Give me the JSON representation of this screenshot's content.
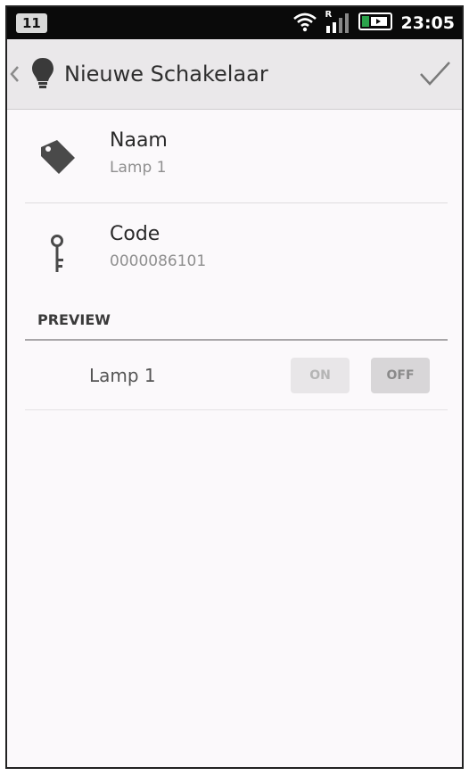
{
  "status_bar": {
    "notification_count": "11",
    "signal_label": "R",
    "time": "23:05"
  },
  "action_bar": {
    "title": "Nieuwe Schakelaar"
  },
  "fields": [
    {
      "label": "Naam",
      "value": "Lamp 1",
      "icon": "tag-icon"
    },
    {
      "label": "Code",
      "value": "0000086101",
      "icon": "key-icon"
    }
  ],
  "preview": {
    "header": "PREVIEW",
    "item_name": "Lamp 1",
    "on_label": "ON",
    "off_label": "OFF"
  },
  "colors": {
    "background": "#fbf9fb",
    "action_bar": "#eae8ea",
    "status_bar": "#0a0a0a"
  }
}
